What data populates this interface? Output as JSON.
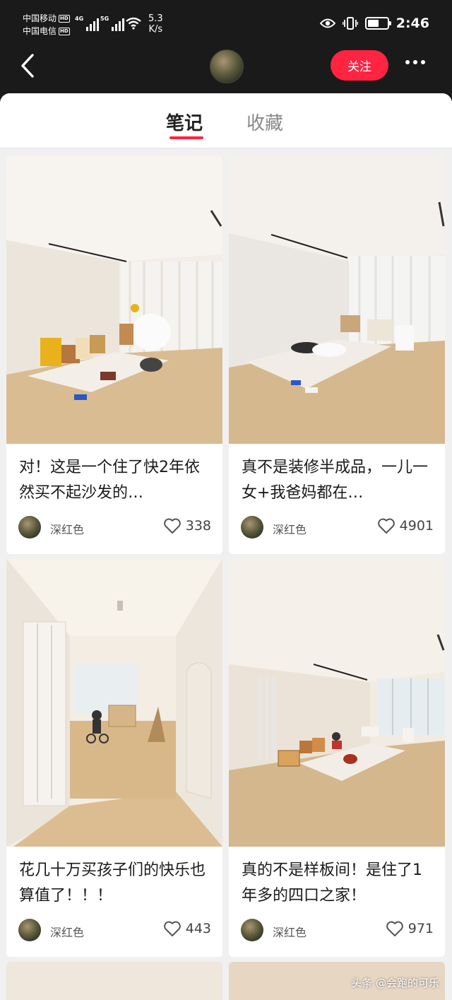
{
  "status_bar": {
    "carrier_1": "中国移动",
    "carrier_2": "中国电信",
    "hd": "HD",
    "net_1": "4G",
    "net_2": "5G",
    "speed_value": "5.3",
    "speed_unit": "K/s",
    "time": "2:46",
    "battery_level": 0.6
  },
  "header": {
    "follow_label": "关注"
  },
  "tabs": [
    {
      "label": "笔记",
      "active": true
    },
    {
      "label": "收藏",
      "active": false
    }
  ],
  "notes": [
    {
      "title": "对！这是一个住了快2年依然买不起沙发的…",
      "author": "深红色",
      "likes": "338"
    },
    {
      "title": "真不是装修半成品，一儿一女+我爸妈都在…",
      "author": "深红色",
      "likes": "4901"
    },
    {
      "title": "花几十万买孩子们的快乐也算值了！！！",
      "author": "深红色",
      "likes": "443"
    },
    {
      "title": "真的不是样板间！是住了1年多的四口之家！",
      "author": "深红色",
      "likes": "971"
    }
  ],
  "watermark": "头条 @会跑的可乐",
  "colors": {
    "accent": "#ff2442",
    "header_bg": "#1a1a1a",
    "wall": "#efe9e2",
    "floor": "#d6b88e"
  }
}
